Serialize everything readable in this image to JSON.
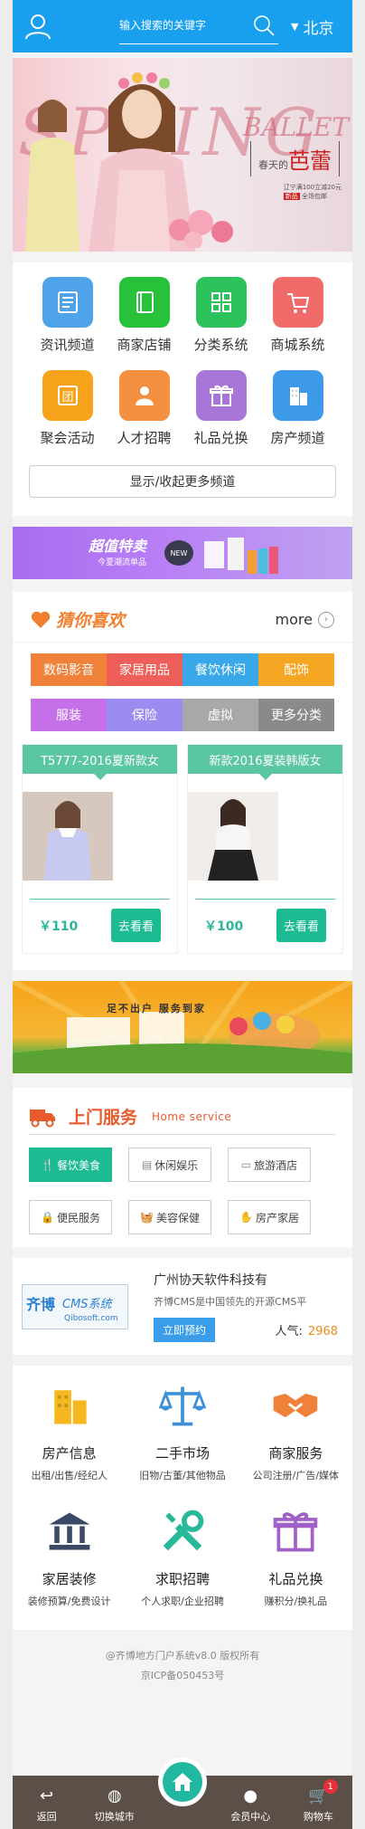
{
  "header": {
    "search_placeholder": "输入搜索的关键字",
    "city": "北京"
  },
  "banner": {
    "spring_text": "SPRING",
    "ballet_text": "BALLET",
    "tag_small": "春天的",
    "tag_big": "芭蕾",
    "promo_line1": "辽宁满100立减20元",
    "promo_new": "新品",
    "promo_line2": "全场包邮"
  },
  "channels": {
    "items": [
      {
        "label": "资讯频道",
        "icon": "news-icon",
        "color": "#4fa3e8"
      },
      {
        "label": "商家店铺",
        "icon": "shop-book-icon",
        "color": "#28c23a"
      },
      {
        "label": "分类系统",
        "icon": "category-grid-icon",
        "color": "#2dc25b"
      },
      {
        "label": "商城系统",
        "icon": "cart-icon",
        "color": "#f26b6b"
      },
      {
        "label": "聚会活动",
        "icon": "group-icon",
        "color": "#f7a21b"
      },
      {
        "label": "人才招聘",
        "icon": "person-icon",
        "color": "#f59040"
      },
      {
        "label": "礼品兑换",
        "icon": "gift-icon",
        "color": "#a876d8"
      },
      {
        "label": "房产频道",
        "icon": "building-icon",
        "color": "#3d9ae8"
      }
    ],
    "more_label": "显示/收起更多频道"
  },
  "deal": {
    "title": "超值特卖",
    "subtitle": "今夏潮流单品",
    "badge": "NEW"
  },
  "guess": {
    "title": "猜你喜欢",
    "more": "more",
    "tags_row1": [
      {
        "label": "数码影音",
        "color": "#f0813a"
      },
      {
        "label": "家居用品",
        "color": "#ef5f5a"
      },
      {
        "label": "餐饮休闲",
        "color": "#3aa8e8"
      },
      {
        "label": "配饰",
        "color": "#f5a623"
      }
    ],
    "tags_row2": [
      {
        "label": "服装",
        "color": "#c570e8"
      },
      {
        "label": "保险",
        "color": "#9a8cf0"
      },
      {
        "label": "虚拟",
        "color": "#a8a8a8"
      },
      {
        "label": "更多分类",
        "color": "#8a8a8a"
      }
    ],
    "products": [
      {
        "title": "T5777-2016夏新款女",
        "price": "￥110",
        "button": "去看看"
      },
      {
        "title": "新款2016夏装韩版女",
        "price": "￥100",
        "button": "去看看"
      }
    ]
  },
  "service_banner": {
    "text": "足不出户  服务到家"
  },
  "home_service": {
    "title": "上门服务",
    "subtitle": "Home service",
    "items": [
      {
        "label": "餐饮美食",
        "icon": "fork-icon",
        "active": true
      },
      {
        "label": "休闲娱乐",
        "icon": "image-icon",
        "active": false
      },
      {
        "label": "旅游酒店",
        "icon": "card-icon",
        "active": false
      },
      {
        "label": "便民服务",
        "icon": "lock-icon",
        "active": false
      },
      {
        "label": "美容保健",
        "icon": "basket-icon",
        "active": false
      },
      {
        "label": "房产家居",
        "icon": "hand-icon",
        "active": false
      }
    ]
  },
  "company": {
    "logo_cn": "齐博",
    "logo_en": "CMS系统",
    "logo_url": "Qibosoft.com",
    "name": "广州协天软件科技有",
    "desc": "齐博CMS是中国领先的开源CMS平",
    "book_label": "立即预约",
    "pop_label": "人气:",
    "pop_value": "2968"
  },
  "categories": [
    {
      "title": "房产信息",
      "sub": "出租/出售/经纪人",
      "icon": "building-icon",
      "color": "#f5b820"
    },
    {
      "title": "二手市场",
      "sub": "旧物/古董/其他物品",
      "icon": "scale-icon",
      "color": "#3d8fd8"
    },
    {
      "title": "商家服务",
      "sub": "公司注册/广告/媒体",
      "icon": "handshake-icon",
      "color": "#f0813a"
    },
    {
      "title": "家居装修",
      "sub": "装修预算/免费设计",
      "icon": "house-columns-icon",
      "color": "#3a4a66"
    },
    {
      "title": "求职招聘",
      "sub": "个人求职/企业招聘",
      "icon": "tools-icon",
      "color": "#28b89a"
    },
    {
      "title": "礼品兑换",
      "sub": "赚积分/换礼品",
      "icon": "gift-icon",
      "color": "#a060c8"
    }
  ],
  "footer": {
    "line1": "@齐博地方门户系统v8.0 版权所有",
    "line2": "京ICP备050453号"
  },
  "bottom_nav": {
    "items": [
      {
        "label": "返回",
        "icon": "back-icon"
      },
      {
        "label": "切换城市",
        "icon": "globe-icon"
      },
      {
        "label": "会员中心",
        "icon": "user-icon"
      },
      {
        "label": "购物车",
        "icon": "cart-icon",
        "badge": "1"
      }
    ]
  }
}
